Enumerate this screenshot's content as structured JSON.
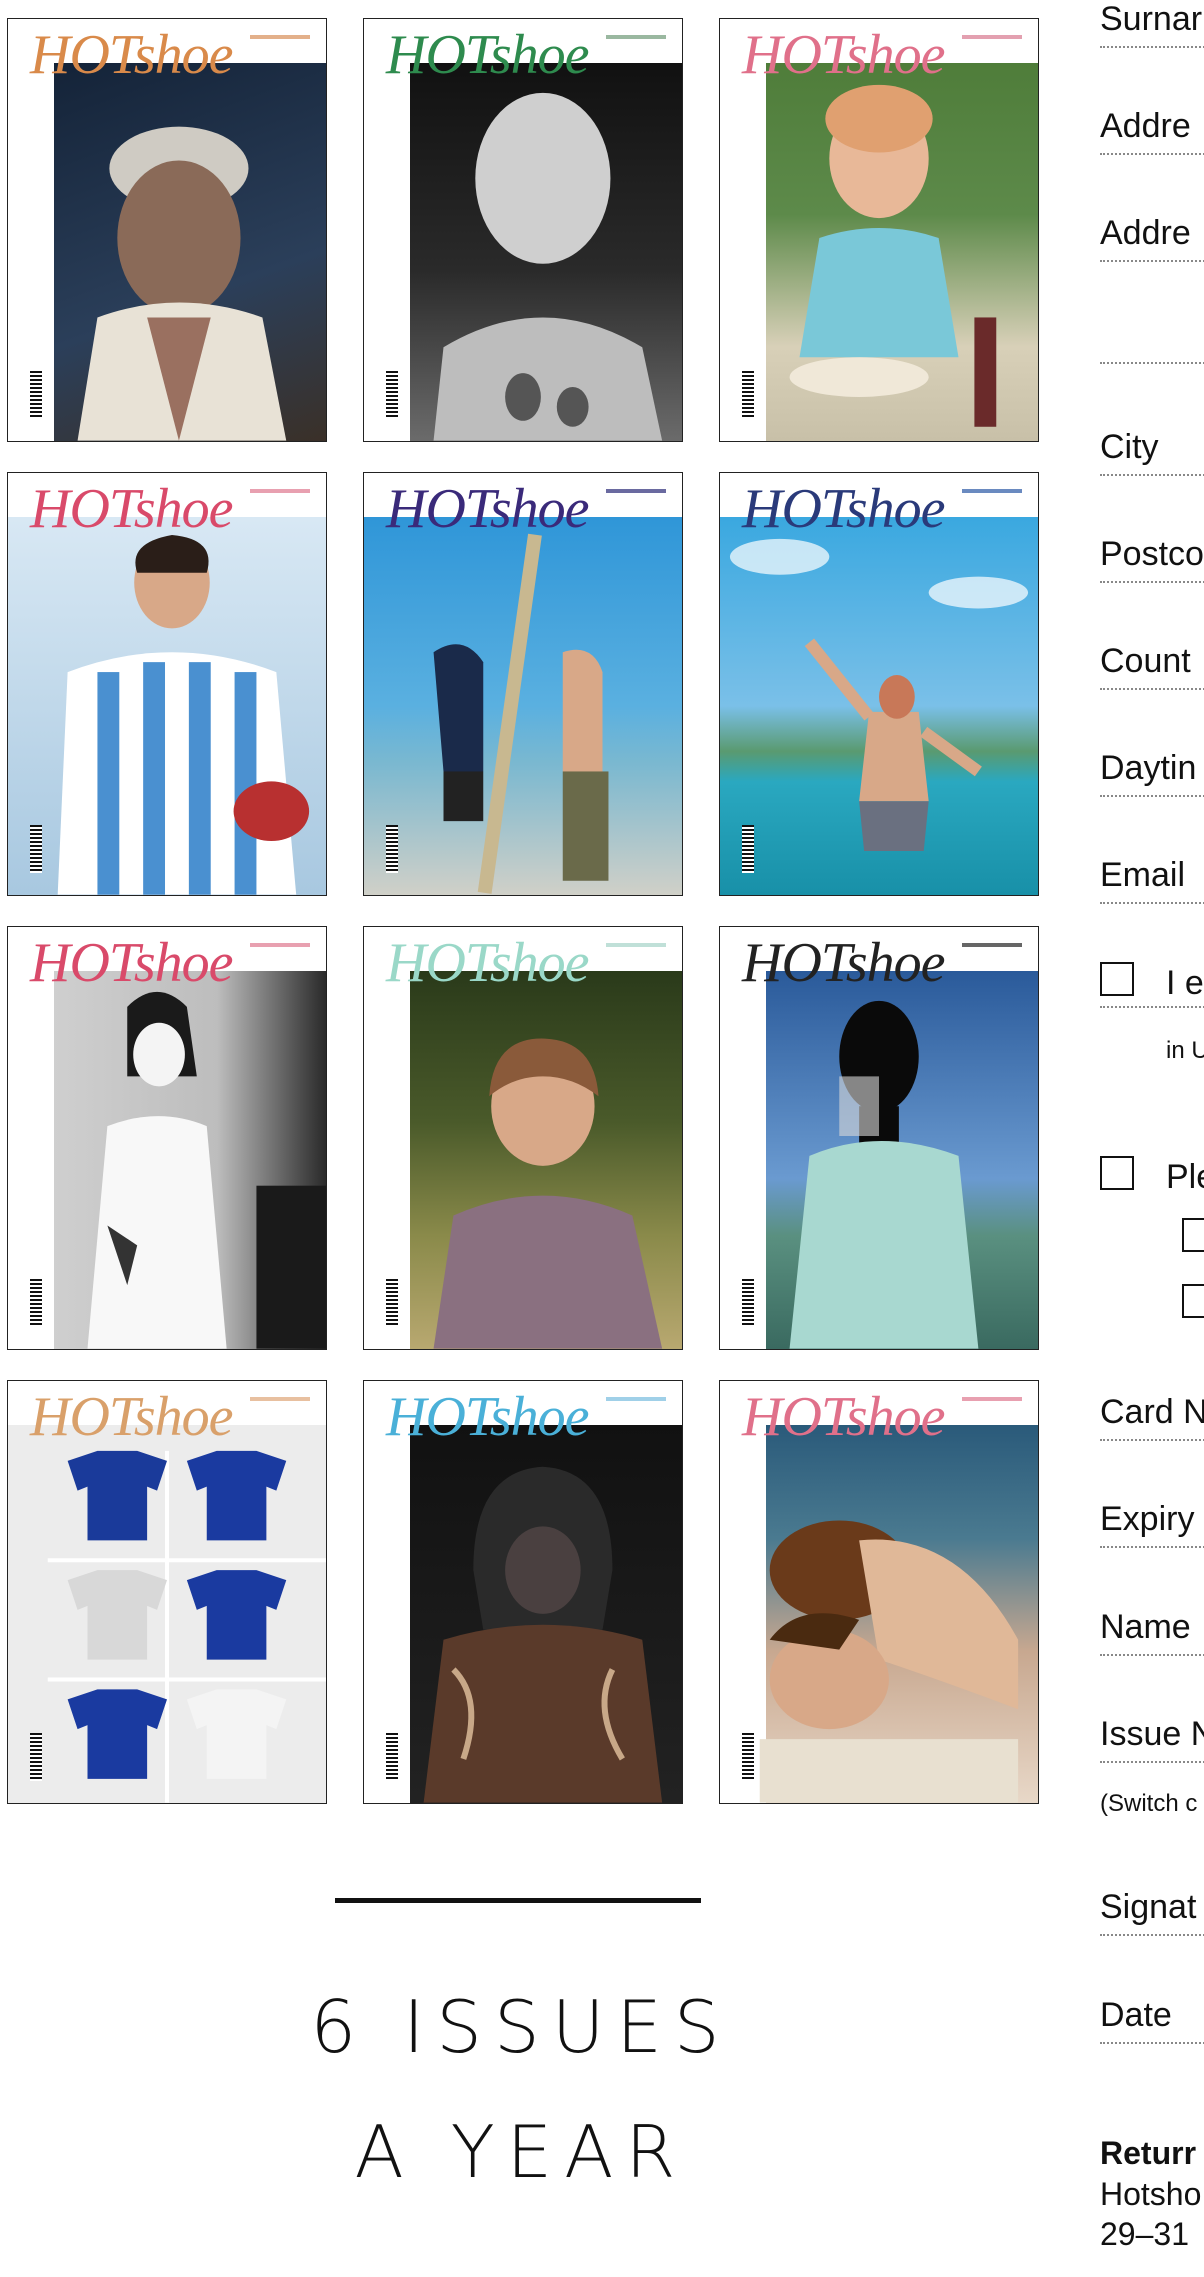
{
  "covers": [
    {
      "masthead": "HOTshoe",
      "masthead_color": "#d98a4a",
      "bg": "#1d2e45"
    },
    {
      "masthead": "HOTshoe",
      "masthead_color": "#2e8b4e",
      "bg": "#1a1a1a"
    },
    {
      "masthead": "HOTshoe",
      "masthead_color": "#e0708a",
      "bg": "#4a7a3a"
    },
    {
      "masthead": "HOTshoe",
      "masthead_color": "#d94a6a",
      "bg": "#8fb8d8"
    },
    {
      "masthead": "HOTshoe",
      "masthead_color": "#3a2a7a",
      "bg": "#3a9ad8"
    },
    {
      "masthead": "HOTshoe",
      "masthead_color": "#2a3a7a",
      "bg": "#3aa8d8"
    },
    {
      "masthead": "HOTshoe",
      "masthead_color": "#d94a6a",
      "bg": "#bdbdbd"
    },
    {
      "masthead": "HOTshoe",
      "masthead_color": "#9ad8c8",
      "bg": "#4a5a2a"
    },
    {
      "masthead": "HOTshoe",
      "masthead_color": "#222222",
      "bg": "#4a7ab0"
    },
    {
      "masthead": "HOTshoe",
      "masthead_color": "#d9a06a",
      "bg": "#eeeeee"
    },
    {
      "masthead": "HOTshoe",
      "masthead_color": "#4ab0d8",
      "bg": "#1a1a1a"
    },
    {
      "masthead": "HOTshoe",
      "masthead_color": "#e0708a",
      "bg": "#3a6a8a"
    }
  ],
  "headline": {
    "line1": "6 ISSUES",
    "line2": "A YEAR"
  },
  "form": {
    "surname": "Surnar",
    "address1": "Addre",
    "address2": "Addre",
    "city": "City",
    "postcode": "Postco",
    "country": "Count",
    "daytime": "Daytin",
    "email": "Email",
    "checkbox1_text": "I e",
    "checkbox1_sub": "in U",
    "checkbox2_text": "Ple",
    "card_number": "Card N",
    "expiry": "Expiry",
    "name": "Name",
    "issue": "Issue N",
    "switch_note": "(Switch c",
    "signature": "Signat",
    "date": "Date",
    "return_title": "Returr",
    "return_line1": "Hotsho",
    "return_line2": "29–31"
  }
}
